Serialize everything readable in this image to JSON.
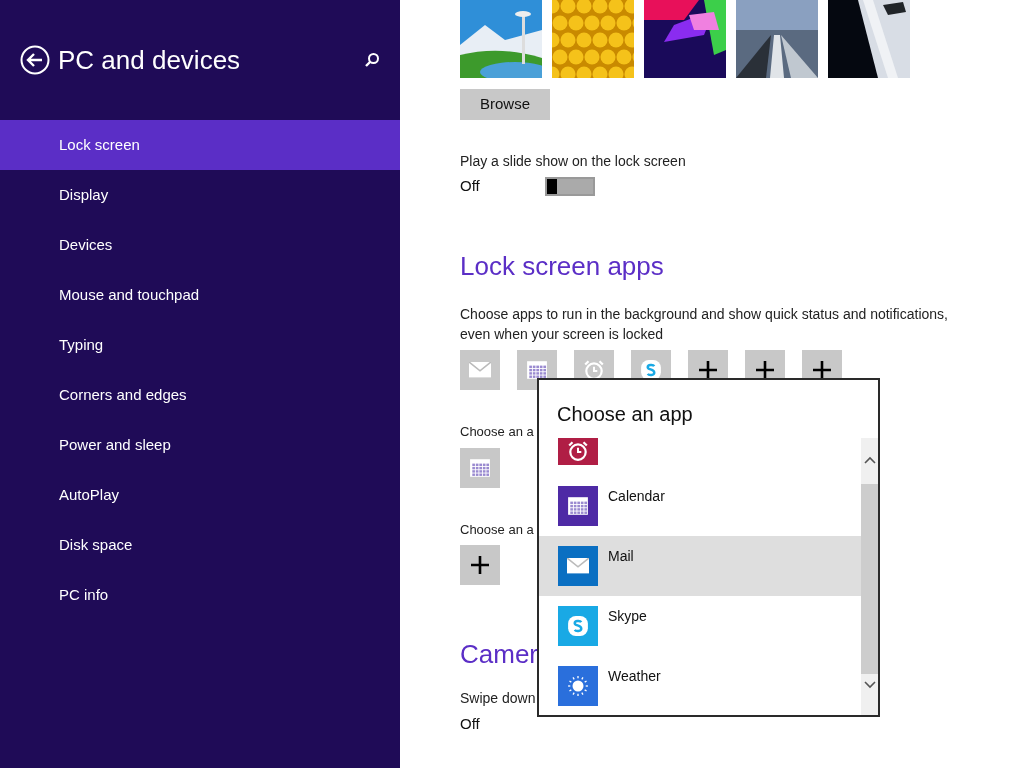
{
  "sidebar": {
    "title": "PC and devices",
    "items": [
      {
        "label": "Lock screen",
        "selected": true
      },
      {
        "label": "Display",
        "selected": false
      },
      {
        "label": "Devices",
        "selected": false
      },
      {
        "label": "Mouse and touchpad",
        "selected": false
      },
      {
        "label": "Typing",
        "selected": false
      },
      {
        "label": "Corners and edges",
        "selected": false
      },
      {
        "label": "Power and sleep",
        "selected": false
      },
      {
        "label": "AutoPlay",
        "selected": false
      },
      {
        "label": "Disk space",
        "selected": false
      },
      {
        "label": "PC info",
        "selected": false
      }
    ]
  },
  "browse_button": "Browse",
  "slideshow": {
    "label": "Play a slide show on the lock screen",
    "state": "Off",
    "on": false
  },
  "lock_screen_apps": {
    "heading": "Lock screen apps",
    "description": "Choose apps to run in the background and show quick status and notifications, even when your screen is locked",
    "slots": [
      {
        "kind": "mail"
      },
      {
        "kind": "calendar"
      },
      {
        "kind": "alarm"
      },
      {
        "kind": "skype"
      },
      {
        "kind": "add"
      },
      {
        "kind": "add"
      },
      {
        "kind": "add"
      }
    ]
  },
  "detailed_status": {
    "label": "Choose an a",
    "slot": {
      "kind": "calendar"
    }
  },
  "alarm_app": {
    "label": "Choose an a",
    "slot": {
      "kind": "add"
    }
  },
  "camera": {
    "heading": "Camer",
    "label": "Swipe down",
    "state": "Off"
  },
  "popup": {
    "title": "Choose an app",
    "items": [
      {
        "kind": "alarm",
        "color": "#b01e45",
        "selected": false
      },
      {
        "kind": "calendar",
        "name": "Calendar",
        "color": "#4e2aa5",
        "selected": false
      },
      {
        "kind": "mail",
        "name": "Mail",
        "color": "#0a6fc2",
        "selected": true
      },
      {
        "kind": "skype",
        "name": "Skype",
        "color": "#19a9e5",
        "selected": false
      },
      {
        "kind": "weather",
        "name": "Weather",
        "color": "#2a6fdc",
        "selected": false
      }
    ]
  }
}
